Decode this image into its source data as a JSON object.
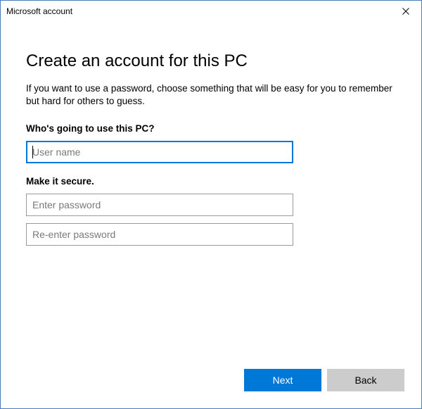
{
  "window": {
    "title": "Microsoft account"
  },
  "page": {
    "heading": "Create an account for this PC",
    "description": "If you want to use a password, choose something that will be easy for you to remember but hard for others to guess."
  },
  "user_section": {
    "label": "Who's going to use this PC?",
    "username_placeholder": "User name",
    "username_value": ""
  },
  "secure_section": {
    "label": "Make it secure.",
    "password_placeholder": "Enter password",
    "password_value": "",
    "confirm_placeholder": "Re-enter password",
    "confirm_value": ""
  },
  "footer": {
    "next_label": "Next",
    "back_label": "Back"
  }
}
